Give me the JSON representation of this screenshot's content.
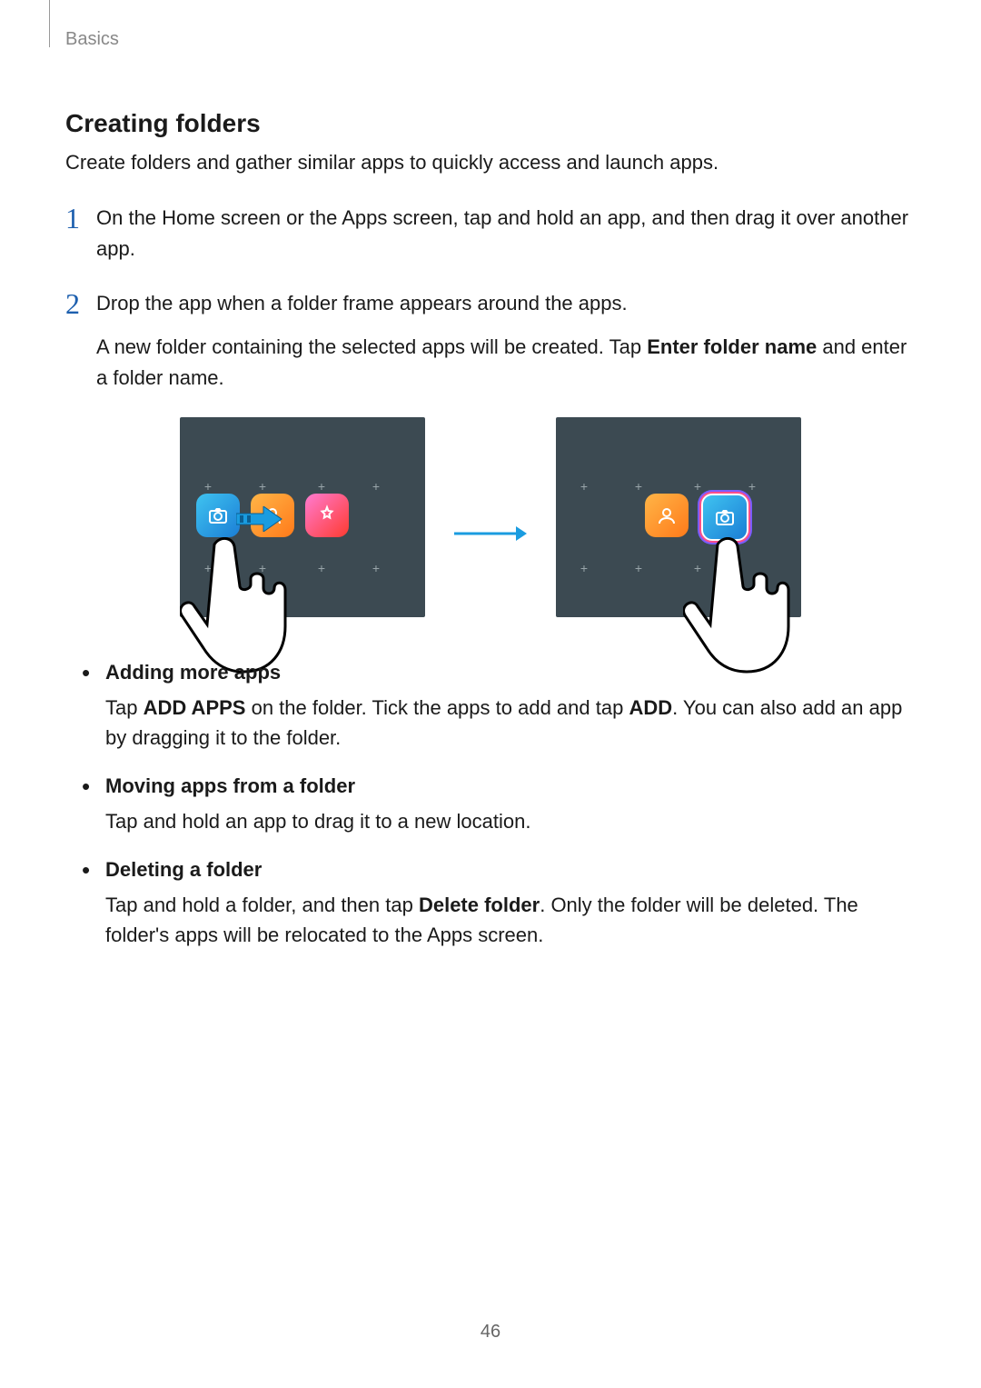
{
  "header": {
    "chapter": "Basics"
  },
  "section": {
    "title": "Creating folders"
  },
  "intro": "Create folders and gather similar apps to quickly access and launch apps.",
  "steps": {
    "s1": {
      "num": "1",
      "text": "On the Home screen or the Apps screen, tap and hold an app, and then drag it over another app."
    },
    "s2": {
      "num": "2",
      "line1": "Drop the app when a folder frame appears around the apps.",
      "line2a": "A new folder containing the selected apps will be created. Tap ",
      "line2bold": "Enter folder name",
      "line2b": " and enter a folder name."
    }
  },
  "bullets": {
    "b1": {
      "title": "Adding more apps",
      "pre": "Tap ",
      "bold1": "ADD APPS",
      "mid": " on the folder. Tick the apps to add and tap ",
      "bold2": "ADD",
      "post": ". You can also add an app by dragging it to the folder."
    },
    "b2": {
      "title": "Moving apps from a folder",
      "text": "Tap and hold an app to drag it to a new location."
    },
    "b3": {
      "title": "Deleting a folder",
      "pre": "Tap and hold a folder, and then tap ",
      "bold": "Delete folder",
      "post": ". Only the folder will be deleted. The folder's apps will be relocated to the Apps screen."
    }
  },
  "page_number": "46"
}
